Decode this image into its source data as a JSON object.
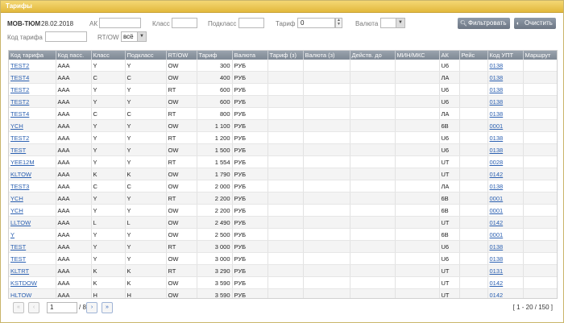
{
  "window": {
    "title": "Тарифы"
  },
  "filters": {
    "route": "МОВ-ТЮМ",
    "date": "28.02.2018",
    "ak_label": "АК",
    "ak_value": "",
    "class_label": "Класс",
    "class_value": "",
    "subclass_label": "Подкласс",
    "subclass_value": "",
    "tariff_label": "Тариф",
    "tariff_value": "0",
    "currency_label": "Валюта",
    "currency_value": "",
    "code_label": "Код тарифа",
    "code_value": "",
    "rtow_label": "RT/OW",
    "rtow_value": "всё",
    "filter_button": "Фильтровать",
    "clear_button": "Очистить"
  },
  "table": {
    "columns": [
      "Код тарифа",
      "Код пасс.",
      "Класс",
      "Подкласс",
      "RT/OW",
      "Тариф",
      "Валюта",
      "Тариф (з)",
      "Валюта (з)",
      "Действ. до",
      "МИН/МКС",
      "АК",
      "Рейс",
      "Код УПТ",
      "Маршрут"
    ],
    "rows": [
      [
        "TEST2",
        "AAA",
        "Y",
        "Y",
        "OW",
        "300",
        "РУБ",
        "",
        "",
        "",
        "",
        "U6",
        "",
        "0138",
        ""
      ],
      [
        "TEST4",
        "AAA",
        "C",
        "C",
        "OW",
        "400",
        "РУБ",
        "",
        "",
        "",
        "",
        "ЛА",
        "",
        "0138",
        ""
      ],
      [
        "TEST2",
        "AAA",
        "Y",
        "Y",
        "RT",
        "600",
        "РУБ",
        "",
        "",
        "",
        "",
        "U6",
        "",
        "0138",
        ""
      ],
      [
        "TEST2",
        "AAA",
        "Y",
        "Y",
        "OW",
        "600",
        "РУБ",
        "",
        "",
        "",
        "",
        "U6",
        "",
        "0138",
        ""
      ],
      [
        "TEST4",
        "AAA",
        "C",
        "C",
        "RT",
        "800",
        "РУБ",
        "",
        "",
        "",
        "",
        "ЛА",
        "",
        "0138",
        ""
      ],
      [
        "YCH",
        "AAA",
        "Y",
        "Y",
        "OW",
        "1 100",
        "РУБ",
        "",
        "",
        "",
        "",
        "6В",
        "",
        "0001",
        ""
      ],
      [
        "TEST2",
        "AAA",
        "Y",
        "Y",
        "RT",
        "1 200",
        "РУБ",
        "",
        "",
        "",
        "",
        "U6",
        "",
        "0138",
        ""
      ],
      [
        "TEST",
        "AAA",
        "Y",
        "Y",
        "OW",
        "1 500",
        "РУБ",
        "",
        "",
        "",
        "",
        "U6",
        "",
        "0138",
        ""
      ],
      [
        "YEE12M",
        "AAA",
        "Y",
        "Y",
        "RT",
        "1 554",
        "РУБ",
        "",
        "",
        "",
        "",
        "UT",
        "",
        "0028",
        ""
      ],
      [
        "KLTOW",
        "AAA",
        "K",
        "K",
        "OW",
        "1 790",
        "РУБ",
        "",
        "",
        "",
        "",
        "UT",
        "",
        "0142",
        ""
      ],
      [
        "TEST3",
        "AAA",
        "C",
        "C",
        "OW",
        "2 000",
        "РУБ",
        "",
        "",
        "",
        "",
        "ЛА",
        "",
        "0138",
        ""
      ],
      [
        "YCH",
        "AAA",
        "Y",
        "Y",
        "RT",
        "2 200",
        "РУБ",
        "",
        "",
        "",
        "",
        "6В",
        "",
        "0001",
        ""
      ],
      [
        "YCH",
        "AAA",
        "Y",
        "Y",
        "OW",
        "2 200",
        "РУБ",
        "",
        "",
        "",
        "",
        "6В",
        "",
        "0001",
        ""
      ],
      [
        "LLTOW",
        "AAA",
        "L",
        "L",
        "OW",
        "2 490",
        "РУБ",
        "",
        "",
        "",
        "",
        "UT",
        "",
        "0142",
        ""
      ],
      [
        "Y",
        "AAA",
        "Y",
        "Y",
        "OW",
        "2 500",
        "РУБ",
        "",
        "",
        "",
        "",
        "6В",
        "",
        "0001",
        ""
      ],
      [
        "TEST",
        "AAA",
        "Y",
        "Y",
        "RT",
        "3 000",
        "РУБ",
        "",
        "",
        "",
        "",
        "U6",
        "",
        "0138",
        ""
      ],
      [
        "TEST",
        "AAA",
        "Y",
        "Y",
        "OW",
        "3 000",
        "РУБ",
        "",
        "",
        "",
        "",
        "U6",
        "",
        "0138",
        ""
      ],
      [
        "KLTRT",
        "AAA",
        "K",
        "K",
        "RT",
        "3 290",
        "РУБ",
        "",
        "",
        "",
        "",
        "UT",
        "",
        "0131",
        ""
      ],
      [
        "KSTDOW",
        "AAA",
        "K",
        "K",
        "OW",
        "3 590",
        "РУБ",
        "",
        "",
        "",
        "",
        "UT",
        "",
        "0142",
        ""
      ],
      [
        "HLTOW",
        "AAA",
        "H",
        "H",
        "OW",
        "3 590",
        "РУБ",
        "",
        "",
        "",
        "",
        "UT",
        "",
        "0142",
        ""
      ]
    ]
  },
  "pager": {
    "page": "1",
    "total_pages": "/ 8",
    "range": "[ 1 - 20 / 150 ]"
  },
  "icons": {
    "first": "first-page-icon",
    "prev": "prev-page-icon",
    "next": "next-page-icon",
    "last": "last-page-icon"
  }
}
